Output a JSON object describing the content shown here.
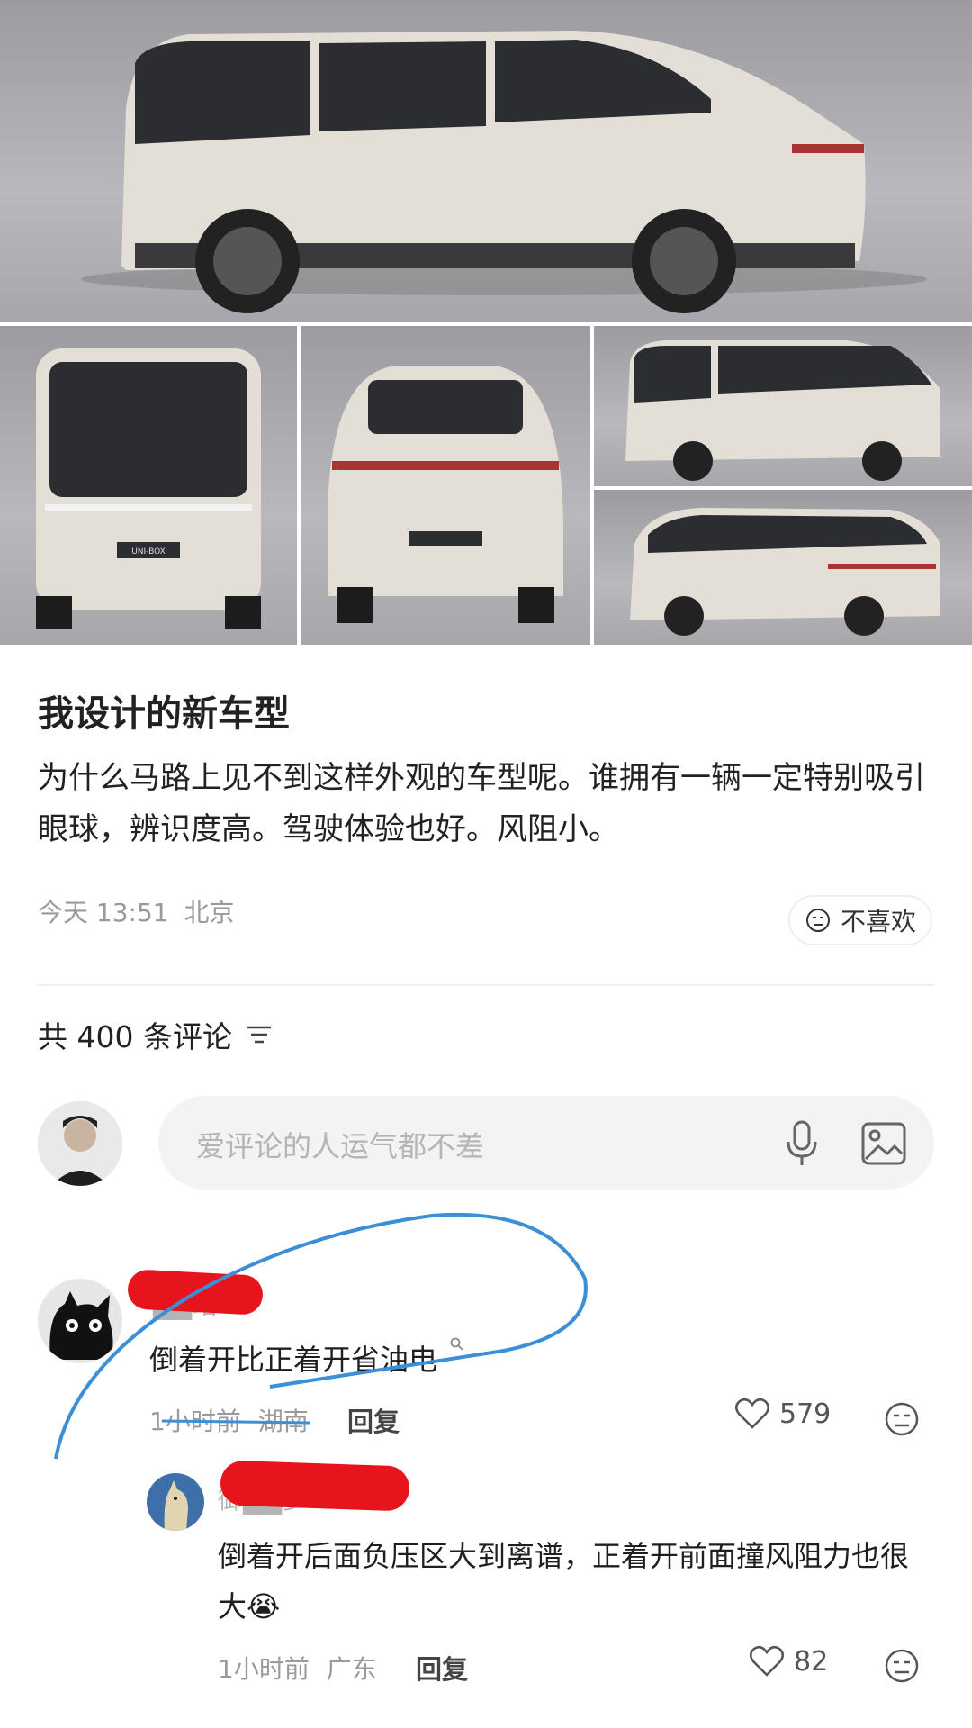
{
  "post": {
    "title": "我设计的新车型",
    "body": "为什么马路上见不到这样外观的车型呢。谁拥有一辆一定特别吸引眼球，辨识度高。驾驶体验也好。风阻小。",
    "time": "今天 13:51",
    "location": "北京",
    "dislike_label": "不喜欢",
    "badge_text": "UNI-BOX"
  },
  "comments_header": {
    "label": "共 400 条评论"
  },
  "composer": {
    "placeholder": "爱评论的人运气都不差"
  },
  "comments": [
    {
      "username": "██站",
      "text": "倒着开比正着开省油电",
      "time": "1小时前",
      "location": "湖南",
      "reply_label": "回复",
      "likes": "579"
    },
    {
      "username": "御██多",
      "text": "倒着开后面负压区大到离谱，正着开前面撞风阻力也很大",
      "emoji": "😭",
      "time": "1小时前",
      "location": "广东",
      "reply_label": "回复",
      "likes": "82"
    }
  ],
  "icons": [
    "microphone-icon",
    "image-icon",
    "sort-icon",
    "meh-face-icon",
    "heart-icon",
    "search-icon"
  ],
  "colors": {
    "annotation": "#3b8fd6",
    "redaction": "#e8141d",
    "muted": "#9a9a9a"
  }
}
